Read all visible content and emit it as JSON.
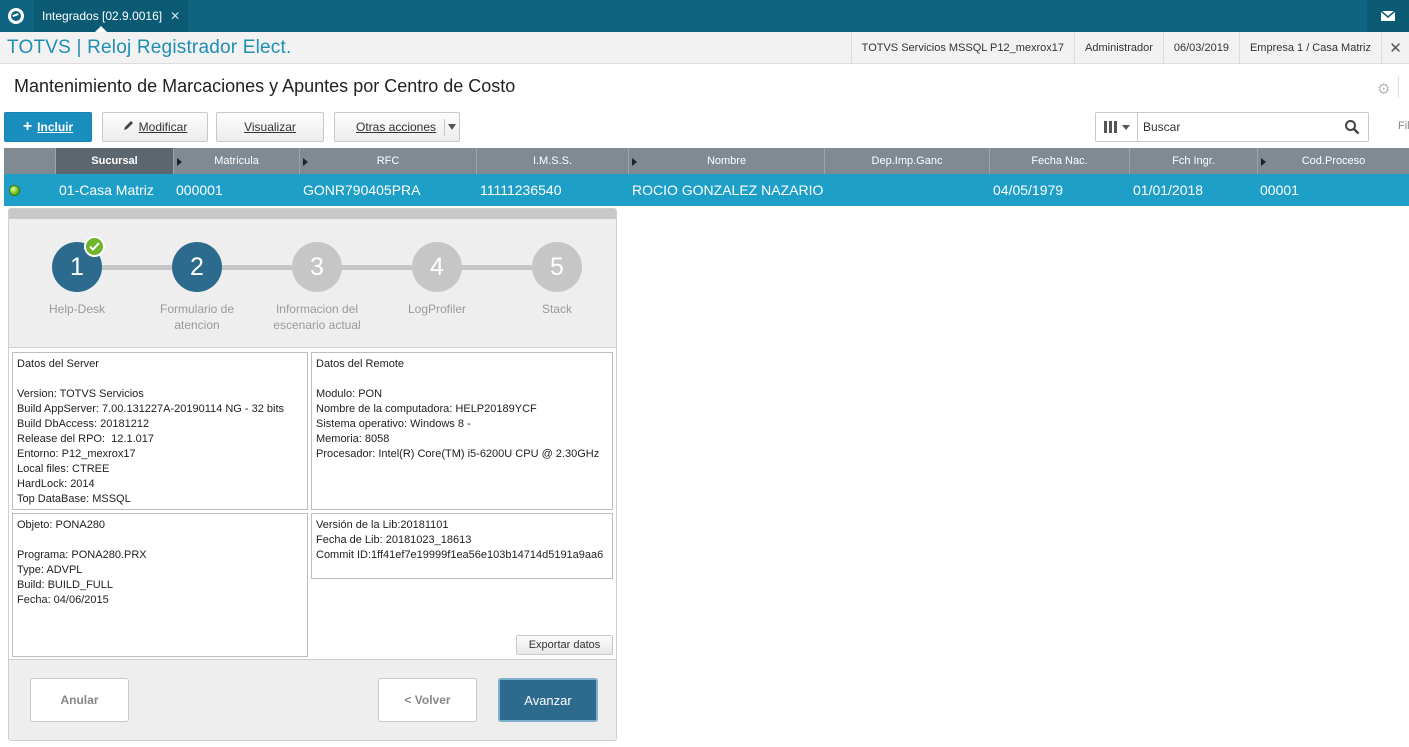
{
  "topbar": {
    "tab_label": "Integrados [02.9.0016]",
    "tab_close": "✕",
    "logo_icon": "totvs-logo-icon",
    "mail_icon": "mail-icon"
  },
  "titlebar": {
    "app_title": "TOTVS | Reloj Registrador Elect.",
    "items": [
      "TOTVS Servicios MSSQL P12_mexrox17",
      "Administrador",
      "06/03/2019",
      "Empresa 1 / Casa Matriz"
    ],
    "close": "✕"
  },
  "page": {
    "title": "Mantenimiento de Marcaciones y Apuntes por Centro de Costo",
    "filter_text": "Fil"
  },
  "toolbar": {
    "include_label": "Incluir",
    "modify_label": "Modificar",
    "view_label": "Visualizar",
    "other_label": "Otras acciones"
  },
  "search": {
    "placeholder": "Buscar"
  },
  "grid": {
    "columns": [
      "Sucursal",
      "Matricula",
      "RFC",
      "I.M.S.S.",
      "Nombre",
      "Dep.Imp.Ganc",
      "Fecha Nac.",
      "Fch Ingr.",
      "Cod.Proceso"
    ],
    "row": {
      "status": "active",
      "sucursal": "01-Casa Matriz",
      "matricula": "000001",
      "rfc": "GONR790405PRA",
      "imss": "11111236540",
      "nombre": "ROCIO  GONZALEZ NAZARIO",
      "dep_imp": "",
      "fecha_nac": "04/05/1979",
      "fch_ingr": "01/01/2018",
      "cod_proceso": "00001"
    }
  },
  "wizard": {
    "steps": [
      {
        "num": "1",
        "label": "Help-Desk",
        "state": "done"
      },
      {
        "num": "2",
        "label": "Formulario de atencion",
        "state": "current"
      },
      {
        "num": "3",
        "label": "Informacion del escenario actual",
        "state": "pending"
      },
      {
        "num": "4",
        "label": "LogProfiler",
        "state": "pending"
      },
      {
        "num": "5",
        "label": "Stack",
        "state": "pending"
      }
    ],
    "server_info": "Datos del Server\n\nVersion: TOTVS Servicios\nBuild AppServer: 7.00.131227A-20190114 NG - 32 bits\nBuild DbAccess: 20181212\nRelease del RPO:  12.1.017\nEntorno: P12_mexrox17\nLocal files: CTREE\nHardLock: 2014\nTop DataBase: MSSQL",
    "remote_info": "Datos del Remote\n\nModulo: PON\nNombre de la computadora: HELP20189YCF\nSistema operativo: Windows 8 -\nMemoria: 8058\nProcesador: Intel(R) Core(TM) i5-6200U CPU @ 2.30GHz",
    "object_info": "Objeto: PONA280\n\nPrograma: PONA280.PRX\nType: ADVPL\nBuild: BUILD_FULL\nFecha: 04/06/2015",
    "lib_info": "Versión de la Lib:20181101\nFecha de Lib: 20181023_18613\nCommit ID:1ff41ef7e19999f1ea56e103b14714d5191a9aa6",
    "export_label": "Exportar datos",
    "cancel_label": "Anular",
    "back_label": "< Volver",
    "next_label": "Avanzar"
  },
  "colors": {
    "topbar": "#0f6581",
    "accent": "#1d8fb3",
    "selected_row": "#1e9fc7",
    "step_active": "#2d6b8e",
    "step_done_check": "#6fb52c"
  }
}
